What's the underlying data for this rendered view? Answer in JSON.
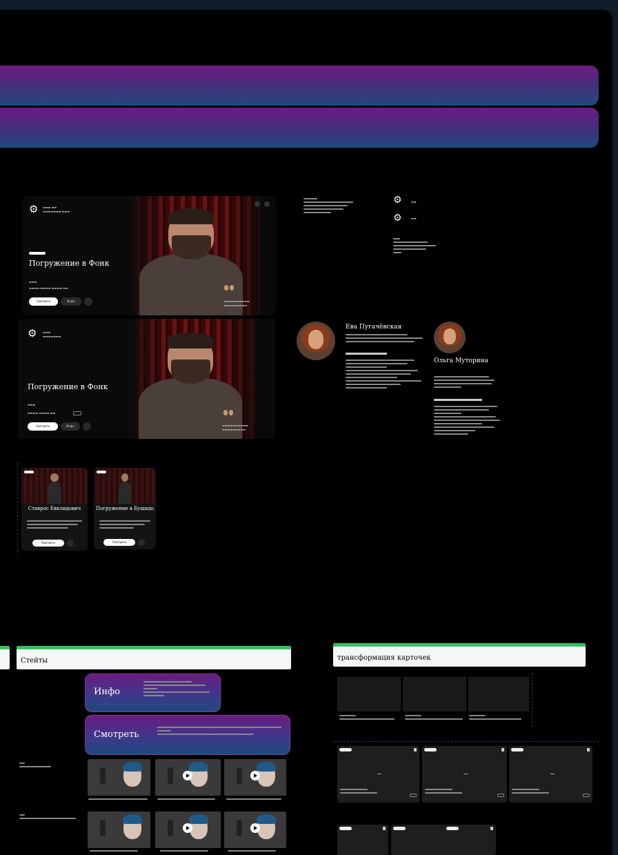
{
  "hero": {
    "title": "Погружение в Фонк",
    "title2": "Погружение в Фонк",
    "btn_primary": "Смотреть",
    "btn_secondary": "Инфо"
  },
  "profiles": [
    {
      "name": "Ева Пугачёвская"
    },
    {
      "name": "Ольга Муторина"
    }
  ],
  "cards": [
    {
      "title": "Ставрос Евклидович"
    },
    {
      "title": "Погружение в Бушидо"
    }
  ],
  "sections": {
    "left_header": "Стейты",
    "right_header": "трансформация карточек"
  },
  "buttons": {
    "small": "Инфо",
    "large": "Смотреть"
  },
  "colors": {
    "accent_purple": "#6b1b82",
    "accent_blue": "#1f4a7c",
    "green": "#2fc560"
  }
}
